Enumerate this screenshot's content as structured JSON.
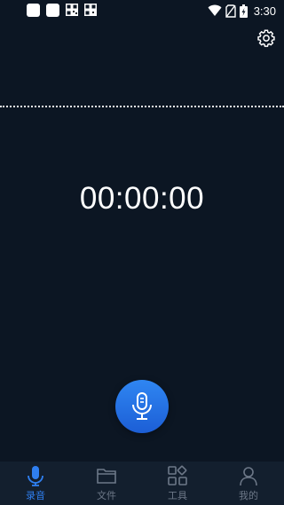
{
  "status_bar": {
    "time": "3:30",
    "icons": [
      "app-square-icon",
      "app-square-icon",
      "qr-code-icon",
      "qr-code-icon",
      "wifi-icon",
      "no-sim-icon",
      "battery-charging-icon"
    ]
  },
  "header": {
    "settings_icon": "gear-icon"
  },
  "recorder": {
    "timer": "00:00:00",
    "record_icon": "microphone-icon"
  },
  "bottom_nav": {
    "items": [
      {
        "label": "录音",
        "icon": "microphone-icon",
        "active": true
      },
      {
        "label": "文件",
        "icon": "folder-icon",
        "active": false
      },
      {
        "label": "工具",
        "icon": "grid-tools-icon",
        "active": false
      },
      {
        "label": "我的",
        "icon": "user-icon",
        "active": false
      }
    ]
  },
  "colors": {
    "background": "#0c1623",
    "nav_background": "#131f2e",
    "accent": "#2f7ff0",
    "inactive": "#6d7888"
  }
}
